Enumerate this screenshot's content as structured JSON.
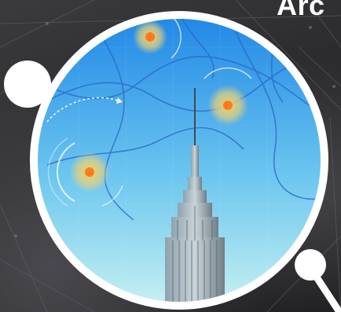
{
  "header": {
    "title_fragment": "Arc"
  },
  "colors": {
    "background": "#2a2a2c",
    "ring": "#ffffff",
    "sky_top": "#1f86e6",
    "sky_bottom": "#c9f2f2",
    "hotspot_core": "#ff7a1a",
    "hotspot_halo": "#f2d26b",
    "route_lines": "#2a66c8"
  },
  "icons": [
    "magnifying-glass-icon",
    "location-hotspot-icon"
  ]
}
